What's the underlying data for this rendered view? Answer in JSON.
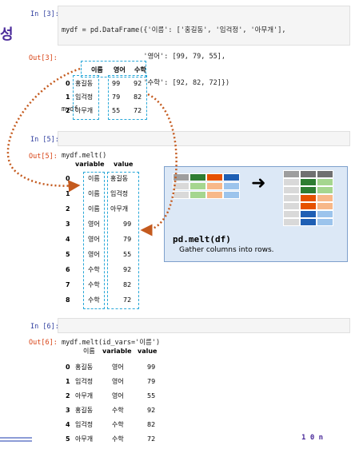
{
  "side_title": "성",
  "cells": [
    {
      "in_label": "In [3]:",
      "code_lines": [
        "mydf = pd.DataFrame({'이름': ['홍길동', '임걱정', '아무개'],",
        "                    '영어': [99, 79, 55],",
        "                    '수학': [92, 82, 72]})",
        "mydf"
      ],
      "out_label": "Out[3]:"
    },
    {
      "in_label": "In [5]:",
      "code_lines": [
        "mydf.melt()"
      ],
      "out_label": "Out[5]:"
    },
    {
      "in_label": "In [6]:",
      "code_lines": [
        "mydf.melt(id_vars='이름')"
      ],
      "out_label": "Out[6]:"
    }
  ],
  "table1": {
    "columns": [
      "이름",
      "영어",
      "수학"
    ],
    "rows": [
      {
        "idx": "0",
        "vals": [
          "홍길동",
          "99",
          "92"
        ]
      },
      {
        "idx": "1",
        "vals": [
          "임걱정",
          "79",
          "82"
        ]
      },
      {
        "idx": "2",
        "vals": [
          "아무개",
          "55",
          "72"
        ]
      }
    ]
  },
  "table2": {
    "columns": [
      "variable",
      "value"
    ],
    "rows": [
      {
        "idx": "0",
        "vals": [
          "이름",
          "홍길동"
        ]
      },
      {
        "idx": "1",
        "vals": [
          "이름",
          "임걱정"
        ]
      },
      {
        "idx": "2",
        "vals": [
          "이름",
          "아무개"
        ]
      },
      {
        "idx": "3",
        "vals": [
          "영어",
          "99"
        ]
      },
      {
        "idx": "4",
        "vals": [
          "영어",
          "79"
        ]
      },
      {
        "idx": "5",
        "vals": [
          "영어",
          "55"
        ]
      },
      {
        "idx": "6",
        "vals": [
          "수학",
          "92"
        ]
      },
      {
        "idx": "7",
        "vals": [
          "수학",
          "82"
        ]
      },
      {
        "idx": "8",
        "vals": [
          "수학",
          "72"
        ]
      }
    ]
  },
  "table3": {
    "columns": [
      "이름",
      "variable",
      "value"
    ],
    "rows": [
      {
        "idx": "0",
        "vals": [
          "홍길동",
          "영어",
          "99"
        ]
      },
      {
        "idx": "1",
        "vals": [
          "임걱정",
          "영어",
          "79"
        ]
      },
      {
        "idx": "2",
        "vals": [
          "아무개",
          "영어",
          "55"
        ]
      },
      {
        "idx": "3",
        "vals": [
          "홍길동",
          "수학",
          "92"
        ]
      },
      {
        "idx": "4",
        "vals": [
          "임걱정",
          "수학",
          "82"
        ]
      },
      {
        "idx": "5",
        "vals": [
          "아무개",
          "수학",
          "72"
        ]
      }
    ]
  },
  "infobox": {
    "code": "pd.melt(df)",
    "caption": "Gather columns into rows."
  },
  "footer": {
    "page_mark": "1 0 n"
  },
  "colors": {
    "dashed_box": "#29a8d8",
    "arrow": "#c45a1e",
    "title": "#4a2a9a",
    "infobox_bg": "#dce8f6"
  }
}
